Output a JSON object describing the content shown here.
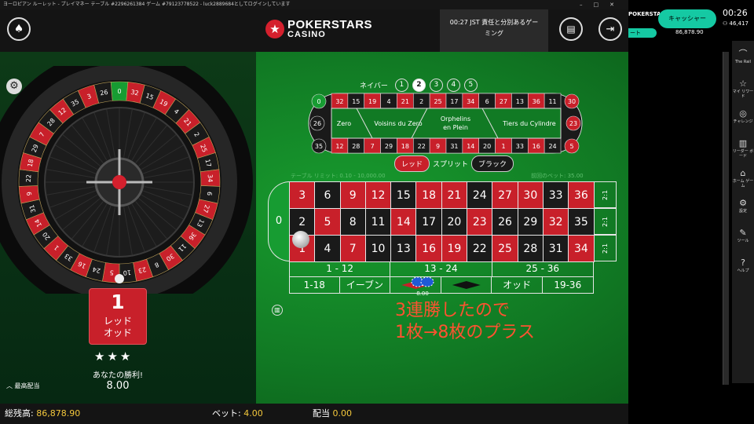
{
  "window": {
    "title": "ヨーロピアン ルーレット - プレイマネー テーブル #2296261384 ゲーム #79123778522 - luck2889684としてログインしています",
    "controls": [
      "–",
      "□",
      "✕"
    ]
  },
  "header": {
    "brand_line1": "POKERSTARS",
    "brand_line2": "CASINO",
    "session_line1": "00:27 JST 責任と分別あるゲー",
    "session_line2": "ミング",
    "icons": [
      "spade-icon",
      "cash-icon",
      "exit-icon"
    ]
  },
  "neighbours": {
    "label": "ネイバー",
    "options": [
      "1",
      "2",
      "3",
      "4",
      "5"
    ],
    "selected": "2"
  },
  "racetrack": {
    "top_row": [
      "0",
      "32",
      "15",
      "19",
      "4",
      "21",
      "2",
      "25",
      "17",
      "34",
      "6",
      "27",
      "13",
      "36",
      "11",
      "30"
    ],
    "bottom_row": [
      "35",
      "12",
      "28",
      "7",
      "29",
      "18",
      "22",
      "9",
      "31",
      "14",
      "20",
      "1",
      "33",
      "16",
      "24",
      "5"
    ],
    "left_cap": [
      "26",
      "3"
    ],
    "right_cap": [
      "8",
      "23",
      "10"
    ],
    "sections": [
      "Zero",
      "Voisins du Zero",
      "Orphelins en Plein",
      "Tiers du Cylindre"
    ]
  },
  "toggle": {
    "red": "レッド",
    "middle": "スプリット",
    "black": "ブラック"
  },
  "table": {
    "limit_label": "テーブル リミット: 0.10 - 10,000.00",
    "prev_bet_label": "前回のベット: 35.00",
    "zero": "0",
    "rows": [
      [
        {
          "n": "3",
          "c": "red"
        },
        {
          "n": "6",
          "c": "black"
        },
        {
          "n": "9",
          "c": "red"
        },
        {
          "n": "12",
          "c": "red"
        },
        {
          "n": "15",
          "c": "black"
        },
        {
          "n": "18",
          "c": "red"
        },
        {
          "n": "21",
          "c": "red"
        },
        {
          "n": "24",
          "c": "black"
        },
        {
          "n": "27",
          "c": "red"
        },
        {
          "n": "30",
          "c": "red"
        },
        {
          "n": "33",
          "c": "black"
        },
        {
          "n": "36",
          "c": "red"
        }
      ],
      [
        {
          "n": "2",
          "c": "black"
        },
        {
          "n": "5",
          "c": "red"
        },
        {
          "n": "8",
          "c": "black"
        },
        {
          "n": "11",
          "c": "black"
        },
        {
          "n": "14",
          "c": "red"
        },
        {
          "n": "17",
          "c": "black"
        },
        {
          "n": "20",
          "c": "black"
        },
        {
          "n": "23",
          "c": "red"
        },
        {
          "n": "26",
          "c": "black"
        },
        {
          "n": "29",
          "c": "black"
        },
        {
          "n": "32",
          "c": "red"
        },
        {
          "n": "35",
          "c": "black"
        }
      ],
      [
        {
          "n": "1",
          "c": "red"
        },
        {
          "n": "4",
          "c": "black"
        },
        {
          "n": "7",
          "c": "red"
        },
        {
          "n": "10",
          "c": "black"
        },
        {
          "n": "13",
          "c": "black"
        },
        {
          "n": "16",
          "c": "red"
        },
        {
          "n": "19",
          "c": "red"
        },
        {
          "n": "22",
          "c": "black"
        },
        {
          "n": "25",
          "c": "red"
        },
        {
          "n": "28",
          "c": "black"
        },
        {
          "n": "31",
          "c": "black"
        },
        {
          "n": "34",
          "c": "red"
        }
      ]
    ],
    "column_bets": [
      "2:1",
      "2:1",
      "2:1"
    ],
    "dozens": [
      "1 - 12",
      "13 - 24",
      "25 - 36"
    ],
    "outside": [
      "1-18",
      "イーブン",
      "",
      "",
      "オッド",
      "19-36"
    ],
    "chip_value": "8.00",
    "colors": {
      "red": "#c8202a",
      "black": "#1a1a1a",
      "zero": "#179c32",
      "felt": "#117a24"
    }
  },
  "wheel": {
    "sequence": [
      "0",
      "32",
      "15",
      "19",
      "4",
      "21",
      "2",
      "25",
      "17",
      "34",
      "6",
      "27",
      "13",
      "36",
      "11",
      "30",
      "8",
      "23",
      "10",
      "5",
      "24",
      "16",
      "33",
      "1",
      "20",
      "14",
      "31",
      "9",
      "22",
      "18",
      "29",
      "7",
      "28",
      "12",
      "35",
      "3",
      "26"
    ],
    "winning_number": "1"
  },
  "result": {
    "number": "1",
    "line1": "レッド",
    "line2": "オッド",
    "win_text": "あなたの勝利!",
    "win_amount": "8.00"
  },
  "max_payout_label": "最高配当",
  "annotation": {
    "line1": "3連勝したので",
    "line2": "1枚→8枚のプラス"
  },
  "bottom": {
    "balance_label": "総残高:",
    "balance_value": "86,878.90",
    "bet_label": "ベット:",
    "bet_value": "4.00",
    "payout_label": "配当",
    "payout_value": "0.00"
  },
  "right_panel": {
    "brand": "POKERSTARS",
    "chip_label": "ート",
    "cashier": "キャッシャー",
    "balance": "86,878.90",
    "time": "00:26",
    "players": "46,417",
    "menu": [
      {
        "label": "The Rail",
        "icon": "rail-icon",
        "glyph": "⌒"
      },
      {
        "label": "マイ リワード",
        "icon": "star-icon",
        "glyph": "☆"
      },
      {
        "label": "チャレンジ",
        "icon": "challenge-icon",
        "glyph": "◎"
      },
      {
        "label": "リーダー ボード",
        "icon": "leaderboard-icon",
        "glyph": "▥"
      },
      {
        "label": "ホーム ゲーム",
        "icon": "home-icon",
        "glyph": "⌂"
      },
      {
        "label": "設定",
        "icon": "gear-icon",
        "glyph": "⚙"
      },
      {
        "label": "ツール",
        "icon": "tool-icon",
        "glyph": "✎"
      },
      {
        "label": "ヘルプ",
        "icon": "help-icon",
        "glyph": "?"
      }
    ]
  }
}
